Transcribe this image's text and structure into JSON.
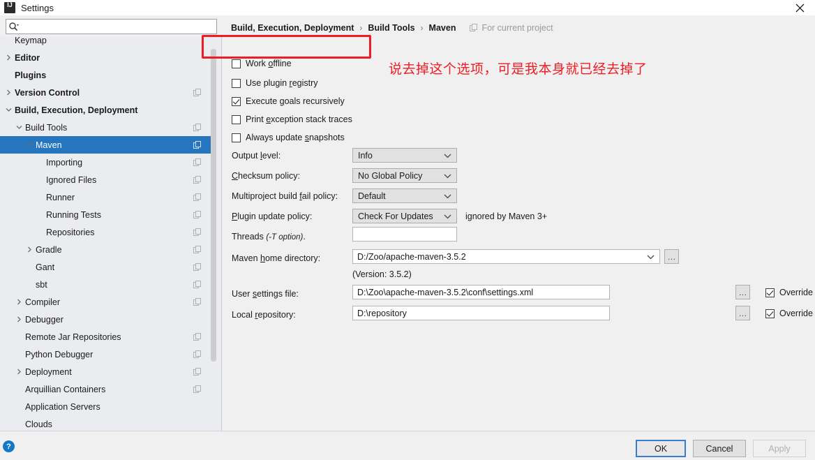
{
  "window": {
    "title": "Settings",
    "app_icon": "intellij-idea-icon",
    "close_icon": "close-icon"
  },
  "search": {
    "value": "",
    "placeholder": "",
    "icon": "search-icon"
  },
  "sidebar": {
    "items": [
      {
        "label": "Keymap",
        "depth": 0,
        "arrow": "none",
        "bold": false,
        "copy": false,
        "selected": false,
        "clipped": true
      },
      {
        "label": "Editor",
        "depth": 0,
        "arrow": "right",
        "bold": true,
        "copy": false,
        "selected": false
      },
      {
        "label": "Plugins",
        "depth": 0,
        "arrow": "none",
        "bold": true,
        "copy": false,
        "selected": false
      },
      {
        "label": "Version Control",
        "depth": 0,
        "arrow": "right",
        "bold": true,
        "copy": true,
        "selected": false
      },
      {
        "label": "Build, Execution, Deployment",
        "depth": 0,
        "arrow": "down",
        "bold": true,
        "copy": false,
        "selected": false
      },
      {
        "label": "Build Tools",
        "depth": 1,
        "arrow": "down",
        "bold": false,
        "copy": true,
        "selected": false
      },
      {
        "label": "Maven",
        "depth": 2,
        "arrow": "down",
        "bold": false,
        "copy": true,
        "selected": true
      },
      {
        "label": "Importing",
        "depth": 3,
        "arrow": "none",
        "bold": false,
        "copy": true,
        "selected": false
      },
      {
        "label": "Ignored Files",
        "depth": 3,
        "arrow": "none",
        "bold": false,
        "copy": true,
        "selected": false
      },
      {
        "label": "Runner",
        "depth": 3,
        "arrow": "none",
        "bold": false,
        "copy": true,
        "selected": false
      },
      {
        "label": "Running Tests",
        "depth": 3,
        "arrow": "none",
        "bold": false,
        "copy": true,
        "selected": false
      },
      {
        "label": "Repositories",
        "depth": 3,
        "arrow": "none",
        "bold": false,
        "copy": true,
        "selected": false
      },
      {
        "label": "Gradle",
        "depth": 2,
        "arrow": "right",
        "bold": false,
        "copy": true,
        "selected": false
      },
      {
        "label": "Gant",
        "depth": 2,
        "arrow": "none",
        "bold": false,
        "copy": true,
        "selected": false
      },
      {
        "label": "sbt",
        "depth": 2,
        "arrow": "none",
        "bold": false,
        "copy": true,
        "selected": false
      },
      {
        "label": "Compiler",
        "depth": 1,
        "arrow": "right",
        "bold": false,
        "copy": true,
        "selected": false
      },
      {
        "label": "Debugger",
        "depth": 1,
        "arrow": "right",
        "bold": false,
        "copy": false,
        "selected": false
      },
      {
        "label": "Remote Jar Repositories",
        "depth": 1,
        "arrow": "none",
        "bold": false,
        "copy": true,
        "selected": false
      },
      {
        "label": "Python Debugger",
        "depth": 1,
        "arrow": "none",
        "bold": false,
        "copy": true,
        "selected": false
      },
      {
        "label": "Deployment",
        "depth": 1,
        "arrow": "right",
        "bold": false,
        "copy": true,
        "selected": false
      },
      {
        "label": "Arquillian Containers",
        "depth": 1,
        "arrow": "none",
        "bold": false,
        "copy": true,
        "selected": false
      },
      {
        "label": "Application Servers",
        "depth": 1,
        "arrow": "none",
        "bold": false,
        "copy": false,
        "selected": false
      },
      {
        "label": "Clouds",
        "depth": 1,
        "arrow": "none",
        "bold": false,
        "copy": false,
        "selected": false
      }
    ]
  },
  "breadcrumb": {
    "part1": "Build, Execution, Deployment",
    "sep": "›",
    "part2": "Build Tools",
    "part3": "Maven",
    "note": "For current project",
    "note_icon": "copy-icon"
  },
  "checkboxes": [
    {
      "label_pre": "Work ",
      "label_mn": "o",
      "label_post": "ffline",
      "checked": false,
      "name": "work-offline"
    },
    {
      "label_pre": "Use plugin ",
      "label_mn": "r",
      "label_post": "egistry",
      "checked": false,
      "name": "use-plugin-registry"
    },
    {
      "label_pre": "Execute ",
      "label_mn": "g",
      "label_post": "oals recursively",
      "checked": true,
      "name": "execute-goals-recursively"
    },
    {
      "label_pre": "Print ",
      "label_mn": "e",
      "label_post": "xception stack traces",
      "checked": false,
      "name": "print-exception-stack-traces"
    },
    {
      "label_pre": "Always update ",
      "label_mn": "s",
      "label_post": "napshots",
      "checked": false,
      "name": "always-update-snapshots"
    }
  ],
  "fields": {
    "output_level": {
      "label_pre": "Output ",
      "label_mn": "l",
      "label_post": "evel:",
      "value": "Info"
    },
    "checksum_policy": {
      "label_pre": "",
      "label_mn": "C",
      "label_post": "hecksum policy:",
      "value": "No Global Policy"
    },
    "multiproject_fail": {
      "label_pre": "Multiproject build ",
      "label_mn": "f",
      "label_post": "ail policy:",
      "value": "Default"
    },
    "plugin_update": {
      "label_pre": "",
      "label_mn": "P",
      "label_post": "lugin update policy:",
      "value": "Check For Updates",
      "hint": "ignored by Maven 3+"
    },
    "threads": {
      "label_pre": "Threads ",
      "label_mn": "",
      "label_post": "",
      "label_italic": "(-T option)",
      "label_tail": ".",
      "value": ""
    },
    "maven_home": {
      "label_pre": "Maven ",
      "label_mn": "h",
      "label_post": "ome directory:",
      "value": "D:/Zoo/apache-maven-3.5.2",
      "version_note": "(Version: 3.5.2)",
      "browse": "…"
    },
    "user_settings": {
      "label_pre": "User ",
      "label_mn": "s",
      "label_post": "ettings file:",
      "value": "D:\\Zoo\\apache-maven-3.5.2\\conf\\settings.xml",
      "browse": "…",
      "override_label": "Override",
      "override_checked": true
    },
    "local_repository": {
      "label_pre": "Local ",
      "label_mn": "r",
      "label_post": "epository:",
      "value": "D:\\repository",
      "browse": "…",
      "override_label": "Override",
      "override_checked": true
    }
  },
  "annotation": {
    "text": "说去掉这个选项，可是我本身就已经去掉了",
    "color": "#ee1c25"
  },
  "footer": {
    "help": "?",
    "ok": "OK",
    "cancel": "Cancel",
    "apply": "Apply"
  }
}
